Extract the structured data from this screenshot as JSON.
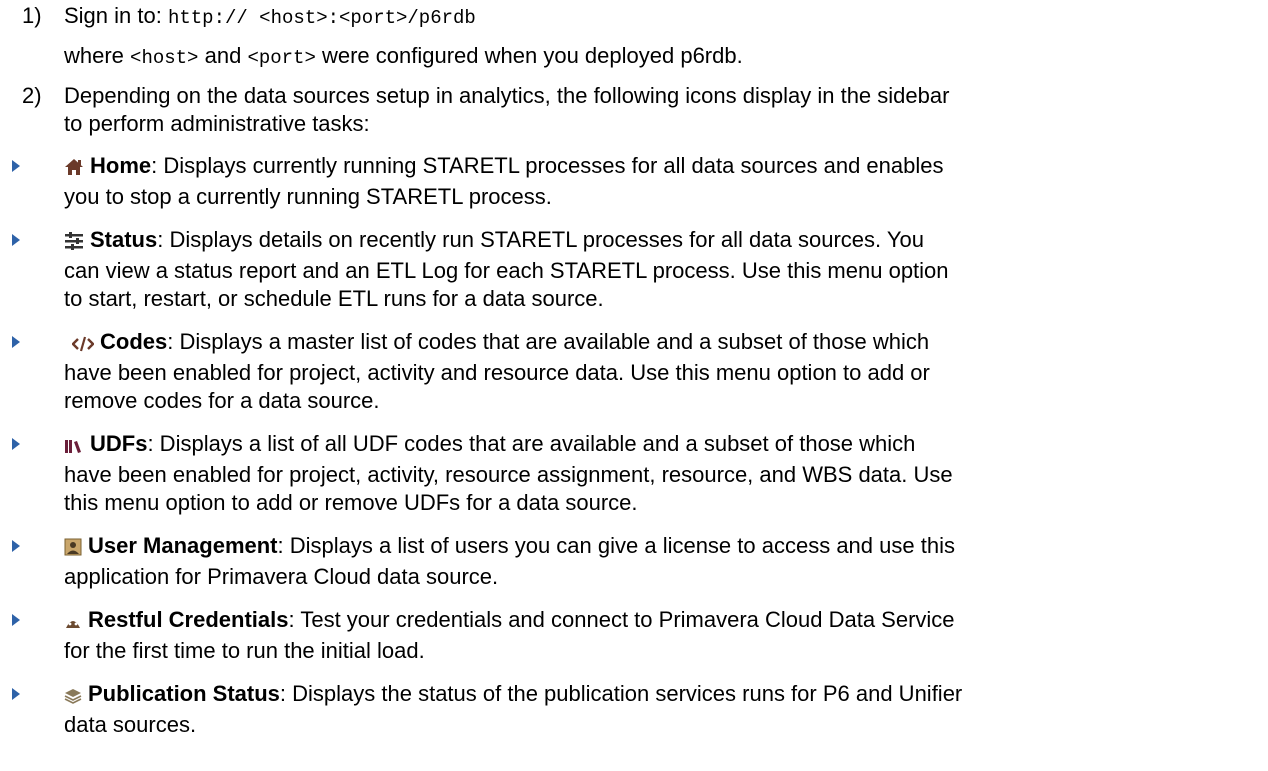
{
  "step1": {
    "number": "1)",
    "prefix": "Sign in to:",
    "url": "http:// <host>:<port>/p6rdb",
    "where_word": "where",
    "host_token": "<host>",
    "and_word": "and",
    "port_token": "<port>",
    "where_rest": "were configured when you deployed p6rdb."
  },
  "step2": {
    "number": "2)",
    "line1": "Depending on the data sources setup in analytics, the following icons display in the sidebar",
    "line2": "to perform administrative tasks:"
  },
  "items": [
    {
      "icon": "home-icon",
      "title": "Home",
      "lines": [
        ": Displays currently running STARETL processes for all data sources and enables",
        "you to stop a currently running STARETL process."
      ]
    },
    {
      "icon": "status-sliders-icon",
      "title": "Status",
      "lines": [
        ": Displays   details on recently run STARETL processes for all data sources. You",
        "can view a status report and an ETL Log for each STARETL process. Use this menu option",
        "to start, restart, or schedule ETL runs for a data source."
      ]
    },
    {
      "icon": "code-icon",
      "title": "Codes",
      "lines": [
        ": Displays a master list of codes that are available and a subset of those which",
        "have been enabled for project, activity and resource data. Use this menu option to add or",
        "remove codes for a data source."
      ]
    },
    {
      "icon": "udf-books-icon",
      "title": "UDFs",
      "lines": [
        ": Displays a list of all UDF codes that are available and a subset of those which",
        "have been enabled for project, activity, resource assignment, resource, and WBS data. Use",
        "this menu option to add or remove UDFs for a data source."
      ]
    },
    {
      "icon": "user-management-icon",
      "title": "User Management",
      "lines": [
        ": Displays a list of users you can give a license to access and use this",
        "application for Primavera Cloud data source."
      ]
    },
    {
      "icon": "restful-credentials-icon",
      "title": "Restful Credentials",
      "lines": [
        ": Test your credentials and connect to Primavera Cloud Data Service",
        "for the first time to run the initial load."
      ]
    },
    {
      "icon": "publication-status-icon",
      "title": "Publication Status",
      "lines": [
        ": Displays the status of the publication services runs for P6 and Unifier",
        "data sources."
      ]
    }
  ],
  "colors": {
    "bullet": "#2e62a8",
    "text": "#000000"
  }
}
